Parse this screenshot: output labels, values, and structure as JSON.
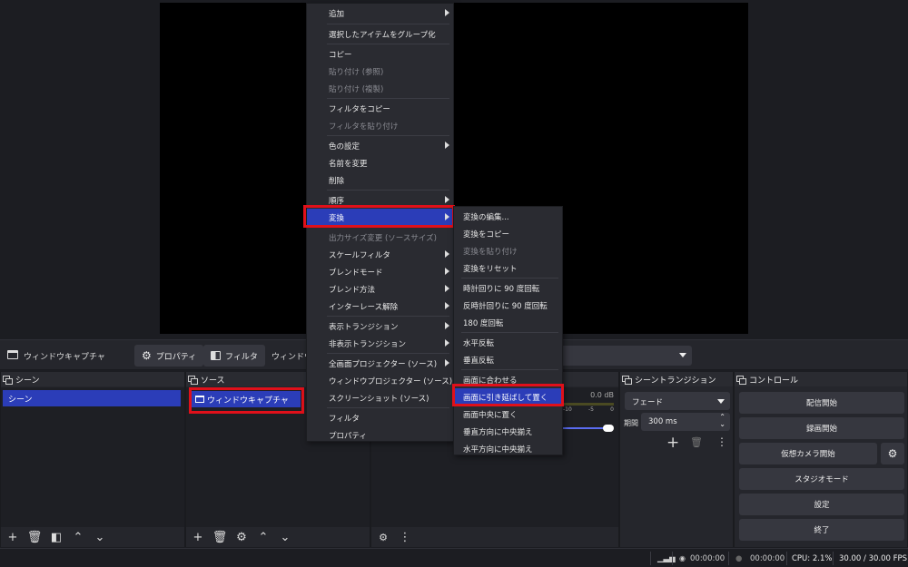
{
  "source_bar": {
    "source_name": "ウィンドウキャプチャ",
    "properties_label": "プロパティ",
    "filters_label": "フィルタ",
    "window_label": "ウィンドウ"
  },
  "docks": {
    "scenes": {
      "title": "シーン",
      "items": [
        "シーン"
      ]
    },
    "sources": {
      "title": "ソース",
      "items": [
        "ウィンドウキャプチャ"
      ]
    },
    "transitions": {
      "title": "シーントランジション",
      "selected": "フェード",
      "duration_label": "期間",
      "duration_value": "300 ms"
    },
    "controls": {
      "title": "コントロール",
      "buttons": [
        "配信開始",
        "録画開始",
        "仮想カメラ開始",
        "スタジオモード",
        "設定",
        "終了"
      ]
    },
    "mixer": {
      "db": "0.0 dB",
      "ticks": [
        "-10",
        "-5",
        "0"
      ]
    }
  },
  "context_menu": {
    "items": [
      {
        "label": "追加",
        "sub": true
      },
      {
        "label": "選択したアイテムをグループ化"
      },
      {
        "label": "コピー"
      },
      {
        "label": "貼り付け (参照)",
        "disabled": true
      },
      {
        "label": "貼り付け (複製)",
        "disabled": true
      },
      {
        "label": "フィルタをコピー"
      },
      {
        "label": "フィルタを貼り付け",
        "disabled": true
      },
      {
        "label": "色の設定",
        "sub": true
      },
      {
        "label": "名前を変更"
      },
      {
        "label": "削除"
      },
      {
        "label": "順序",
        "sub": true
      },
      {
        "label": "変換",
        "sub": true,
        "highlighted": true
      },
      {
        "label": "出力サイズ変更 (ソースサイズ)",
        "disabled": true
      },
      {
        "label": "スケールフィルタ",
        "sub": true
      },
      {
        "label": "ブレンドモード",
        "sub": true
      },
      {
        "label": "ブレンド方法",
        "sub": true
      },
      {
        "label": "インターレース解除",
        "sub": true
      },
      {
        "label": "表示トランジション",
        "sub": true
      },
      {
        "label": "非表示トランジション",
        "sub": true
      },
      {
        "label": "全画面プロジェクター (ソース)",
        "sub": true
      },
      {
        "label": "ウィンドウプロジェクター (ソース)"
      },
      {
        "label": "スクリーンショット (ソース)"
      },
      {
        "label": "フィルタ"
      },
      {
        "label": "プロパティ"
      }
    ]
  },
  "transform_menu": {
    "items": [
      {
        "label": "変換の編集..."
      },
      {
        "label": "変換をコピー"
      },
      {
        "label": "変換を貼り付け",
        "disabled": true
      },
      {
        "label": "変換をリセット"
      },
      {
        "label": "時計回りに 90 度回転"
      },
      {
        "label": "反時計回りに 90 度回転"
      },
      {
        "label": "180 度回転"
      },
      {
        "label": "水平反転"
      },
      {
        "label": "垂直反転"
      },
      {
        "label": "画面に合わせる"
      },
      {
        "label": "画面に引き延ばして置く",
        "highlighted": true
      },
      {
        "label": "画面中央に置く"
      },
      {
        "label": "垂直方向に中央揃え"
      },
      {
        "label": "水平方向に中央揃え"
      }
    ]
  },
  "status_bar": {
    "stream_time": "00:00:00",
    "rec_time": "00:00:00",
    "cpu": "CPU: 2.1%",
    "fps": "30.00 / 30.00 FPS"
  }
}
